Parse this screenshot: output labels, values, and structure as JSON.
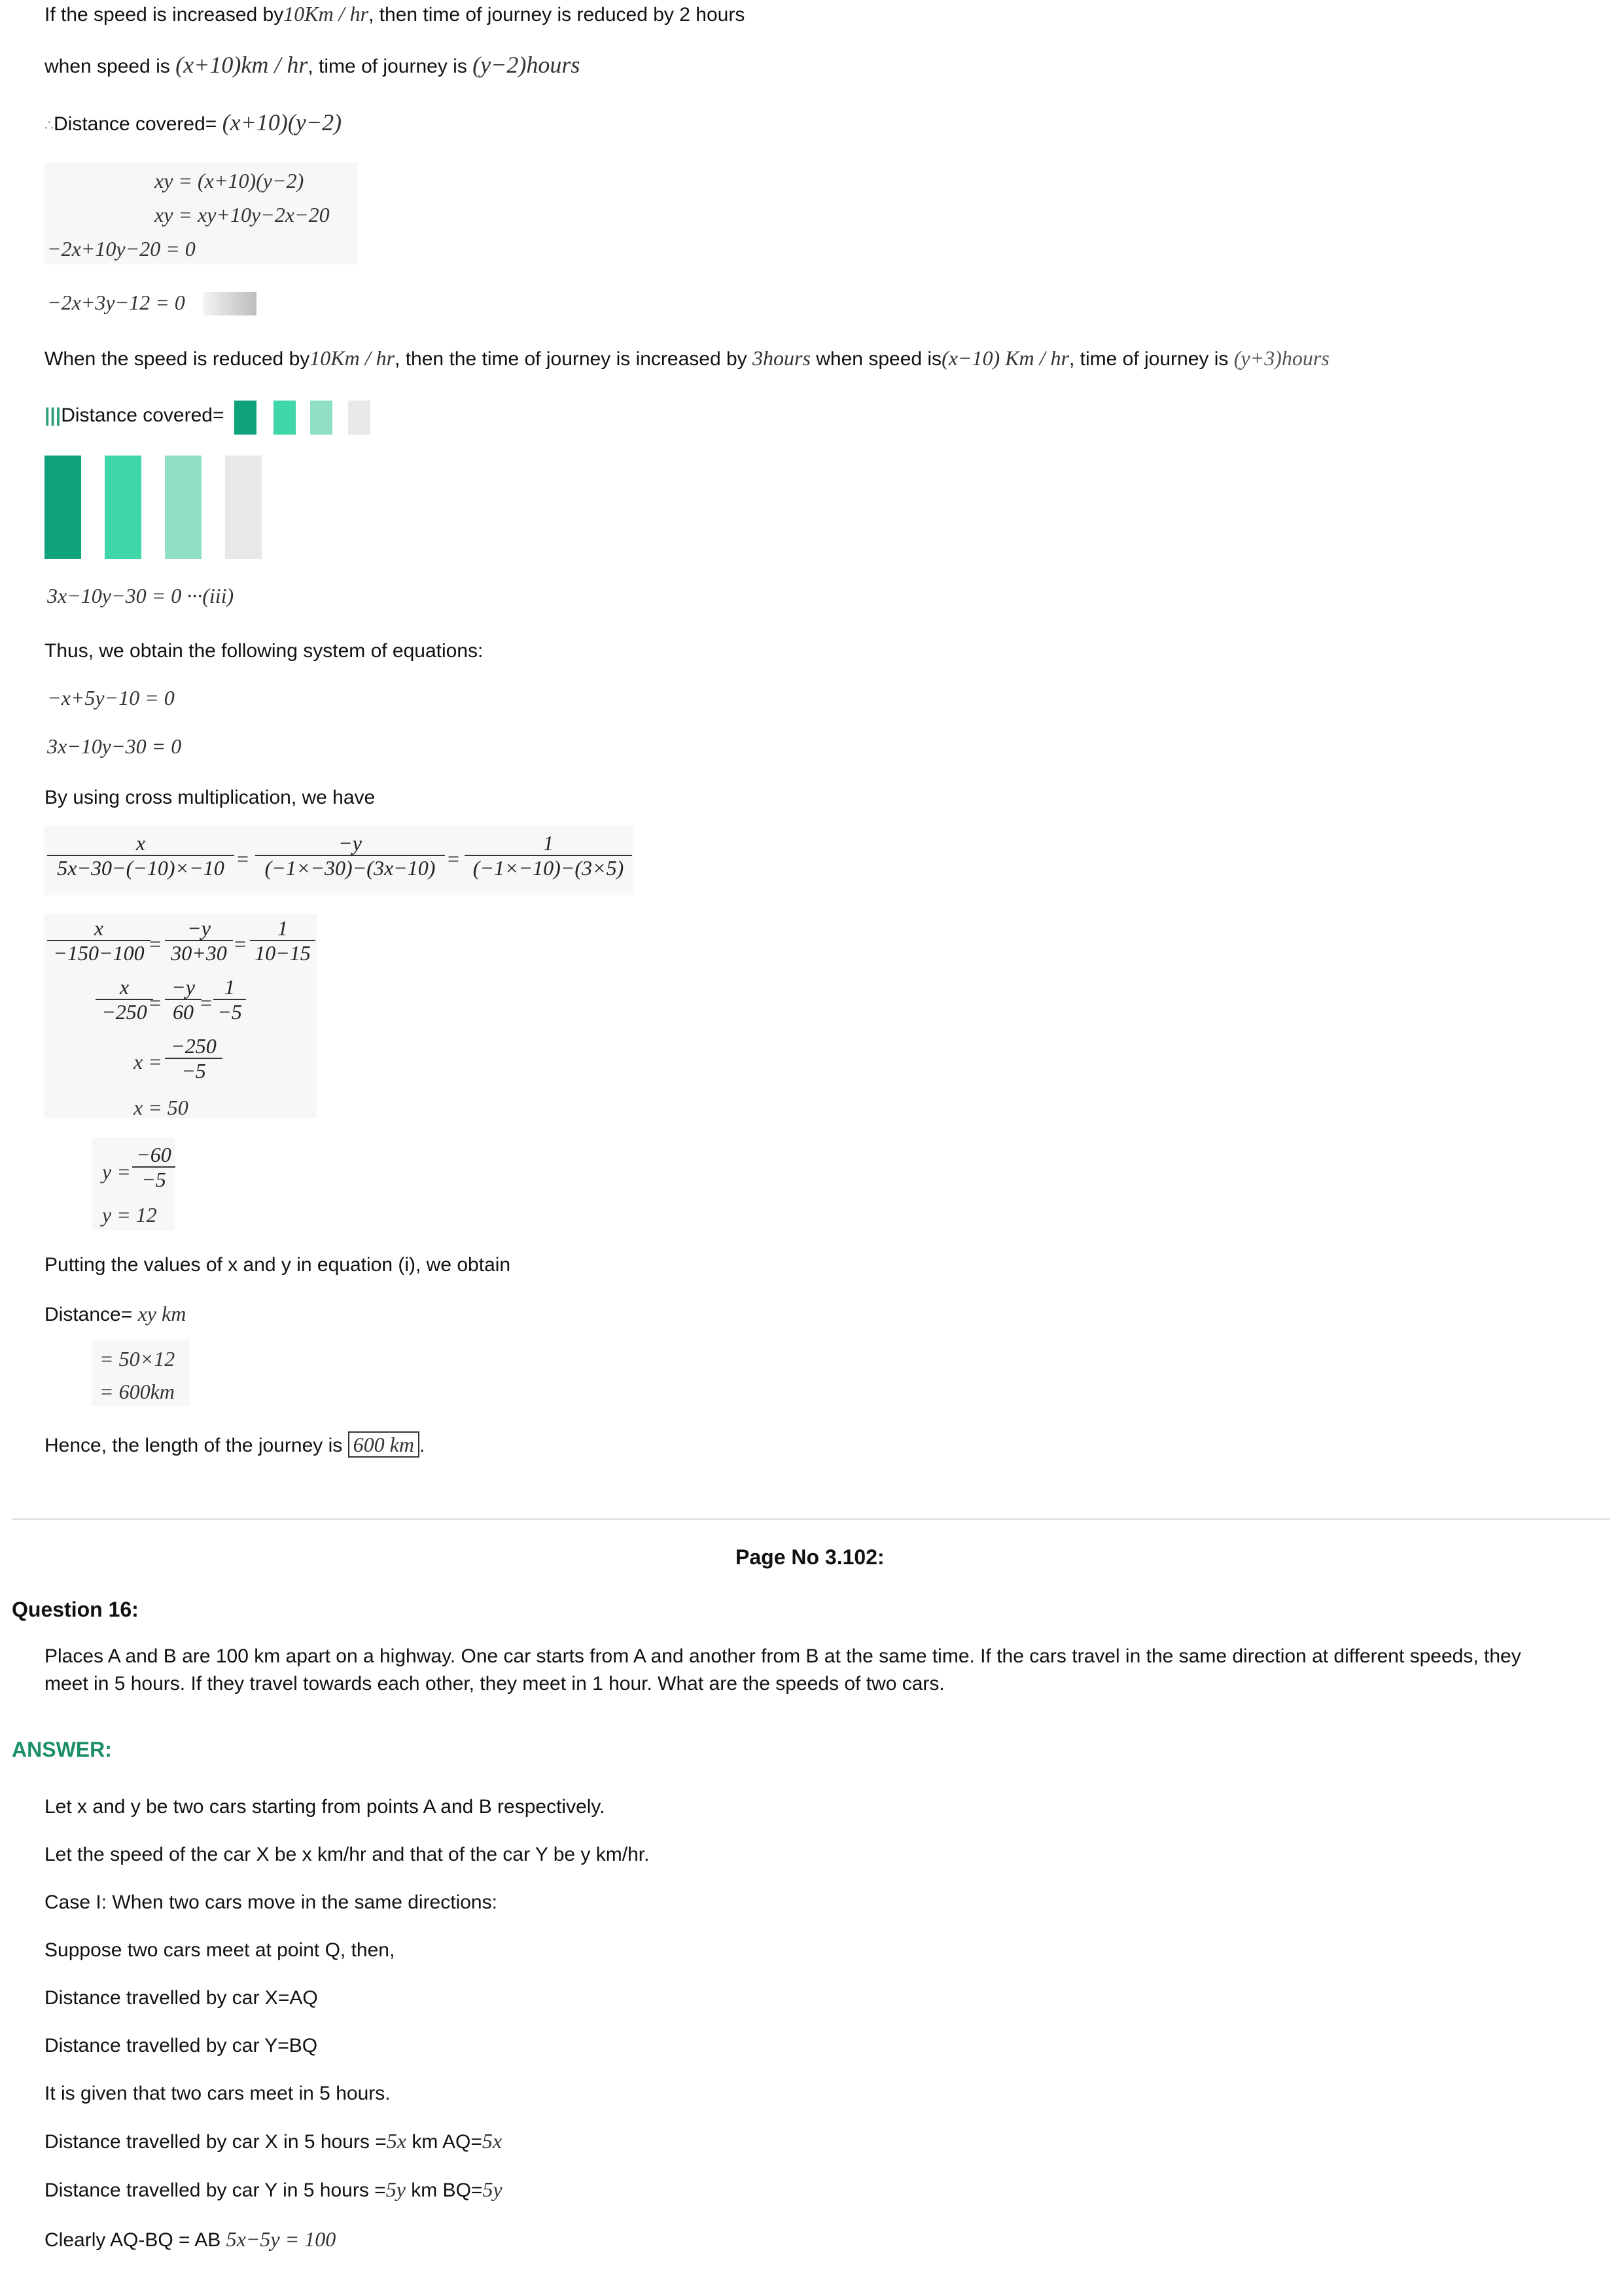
{
  "lines": {
    "l1": "If the speed is increased by",
    "l1_m": "10Km / hr",
    "l1_b": ", then time of journey is reduced by 2 hours",
    "l2": "when speed is",
    "l2_m": "(x+10)km / hr",
    "l2_b": ", time of journey is",
    "l2_m2": "(y−2)hours",
    "l3": "Distance covered=",
    "l3_m": "(x+10)(y−2)",
    "eq1": "xy = (x+10)(y−2)",
    "eq2": "xy = xy+10y−2x−20",
    "eq3": "−2x+10y−20 = 0",
    "eq4": "−2x+3y−12 = 0",
    "l4": "When the speed is reduced by",
    "l4_m": "10Km / hr",
    "l4_b": ", then the time of journey is increased by",
    "l4_m2": "3hours",
    "l4_c": "when speed is",
    "l4_m3": "(x−10) Km / hr",
    "l4_d": ", time of journey is",
    "l4_m4": "(y+3)hours",
    "l5": "Distance covered=",
    "eq5": "3x−10y−30 = 0 ···(iii)",
    "l6": "Thus, we obtain the following system of equations:",
    "eq6": "−x+5y−10 = 0",
    "eq7": "3x−10y−30 = 0",
    "l7": "By using cross multiplication, we have",
    "cm_x": "x",
    "cm_x_den": "5x−30−(−10)×−10",
    "cm_y": "−y",
    "cm_y_den": "(−1×−30)−(3x−10)",
    "cm_1": "1",
    "cm_1_den": "(−1×−10)−(3×5)",
    "s1_x": "x",
    "s1_x_den": "−150−100",
    "s1_y": "−y",
    "s1_y_den": "30+30",
    "s1_1": "1",
    "s1_1_den": "10−15",
    "s2_x": "x",
    "s2_x_den": "−250",
    "s2_y": "−y",
    "s2_y_den": "60",
    "s2_1": "1",
    "s2_1_den": "−5",
    "s3_lhs": "x =",
    "s3_num": "−250",
    "s3_den": "−5",
    "s4": "x = 50",
    "y1_lhs": "y =",
    "y1_num": "−60",
    "y1_den": "−5",
    "y2": "y = 12",
    "l8": "Putting the values of x and y in equation (i), we obtain",
    "l9": "Distance=",
    "l9_m": "xy  km",
    "eq8": "= 50×12",
    "eq9": "= 600km",
    "l10": "Hence, the length of the journey is",
    "l10_box": "600 km",
    "l10_end": "."
  },
  "page_no": "Page No 3.102:",
  "question_label": "Question 16:",
  "question_text_1": "Places A and B are 100 km apart on a highway. One car starts from A and another from B at the same time. If the cars travel in the same direction at different speeds, they",
  "question_text_2": "meet in 5 hours. If they travel towards each other, they meet in 1 hour. What are the speeds of two cars.",
  "answer_label": "ANSWER:",
  "answer_lines": [
    "Let x and y be two cars starting from points A and B respectively.",
    "Let the speed of the car X be x km/hr and that of the car Y be y km/hr.",
    "Case I: When two cars move in the same directions:",
    "Suppose two cars meet at point Q, then,",
    "Distance travelled by car X=AQ",
    "Distance travelled by car Y=BQ",
    "It is given that two cars meet in 5 hours."
  ],
  "answer_tail": {
    "a8": "Distance travelled by car X in 5 hours =",
    "a8_m": "5x",
    "a8_b": "km AQ=",
    "a8_m2": "5x",
    "a9": "Distance travelled by car Y in 5 hours =",
    "a9_m": "5y",
    "a9_b": "km BQ=",
    "a9_m2": "5y",
    "a10": "Clearly AQ-BQ = AB",
    "a10_m": "5x−5y = 100"
  },
  "colors": {
    "answer": "#1a8f6a",
    "sq1": "#0ea37a",
    "sq2": "#3fd6a8",
    "sq3": "#8fe0c4",
    "sq4": "#e8e8e8"
  }
}
